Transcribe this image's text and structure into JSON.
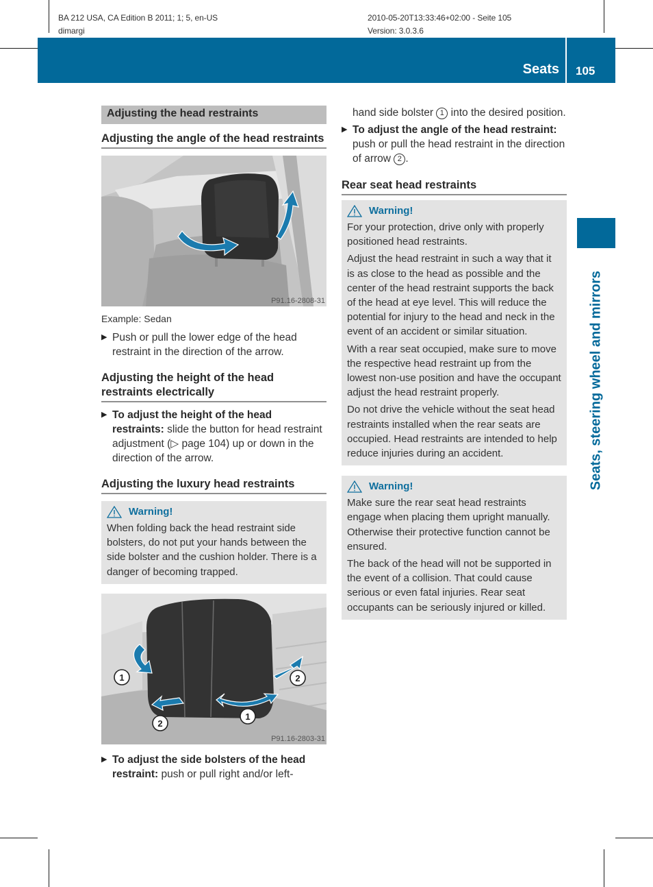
{
  "print_meta": {
    "left_line1": "BA 212 USA, CA Edition B 2011; 1; 5, en-US",
    "left_line2": "dimargi",
    "right_line1": "2010-05-20T13:33:46+02:00 - Seite 105",
    "right_line2": "Version: 3.0.3.6"
  },
  "header": {
    "chapter": "Seats",
    "page_number": "105",
    "accent_color": "#02699a"
  },
  "side_tab": {
    "label": "Seats, steering wheel and mirrors"
  },
  "left_column": {
    "section_title": "Adjusting the head restraints",
    "angle": {
      "heading": "Adjusting the angle of the head restraints",
      "figure_id": "P91.16-2808-31",
      "caption": "Example: Sedan",
      "step": "Push or pull the lower edge of the head restraint in the direction of the arrow."
    },
    "height": {
      "heading": "Adjusting the height of the head restraints electrically",
      "step_bold": "To adjust the height of the head restraints:",
      "step_text": " slide the button for head restraint adjustment (▷ page 104) up or down in the direction of the arrow."
    },
    "luxury": {
      "heading": "Adjusting the luxury head restraints",
      "warning_title": "Warning!",
      "warning_text": "When folding back the head restraint side bolsters, do not put your hands between the side bolster and the cushion holder. There is a danger of becoming trapped.",
      "figure_id": "P91.16-2803-31",
      "callouts": [
        "1",
        "2",
        "1",
        "2"
      ],
      "step_bold": "To adjust the side bolsters of the head restraint:",
      "step_text": " push or pull right and/or left-"
    }
  },
  "right_column": {
    "continued_text_before": "hand side bolster ",
    "continued_callout": "1",
    "continued_text_after": " into the desired position.",
    "angle_step_bold": "To adjust the angle of the head restraint:",
    "angle_step_text": " push or pull the head restraint in the direction of arrow ",
    "angle_step_callout": "2",
    "angle_step_end": ".",
    "rear": {
      "heading": "Rear seat head restraints",
      "warning1": {
        "title": "Warning!",
        "paragraphs": [
          "For your protection, drive only with properly positioned head restraints.",
          "Adjust the head restraint in such a way that it is as close to the head as possible and the center of the head restraint supports the back of the head at eye level. This will reduce the potential for injury to the head and neck in the event of an accident or similar situation.",
          "With a rear seat occupied, make sure to move the respective head restraint up from the lowest non-use position and have the occupant adjust the head restraint properly.",
          "Do not drive the vehicle without the seat head restraints installed when the rear seats are occupied. Head restraints are intended to help reduce injuries during an accident."
        ]
      },
      "warning2": {
        "title": "Warning!",
        "paragraphs": [
          "Make sure the rear seat head restraints engage when placing them upright manually. Otherwise their protective function cannot be ensured.",
          "The back of the head will not be supported in the event of a collision. That could cause serious or even fatal injuries. Rear seat occupants can be seriously injured or killed."
        ]
      }
    }
  },
  "icons": {
    "step_bullet": "▶"
  }
}
